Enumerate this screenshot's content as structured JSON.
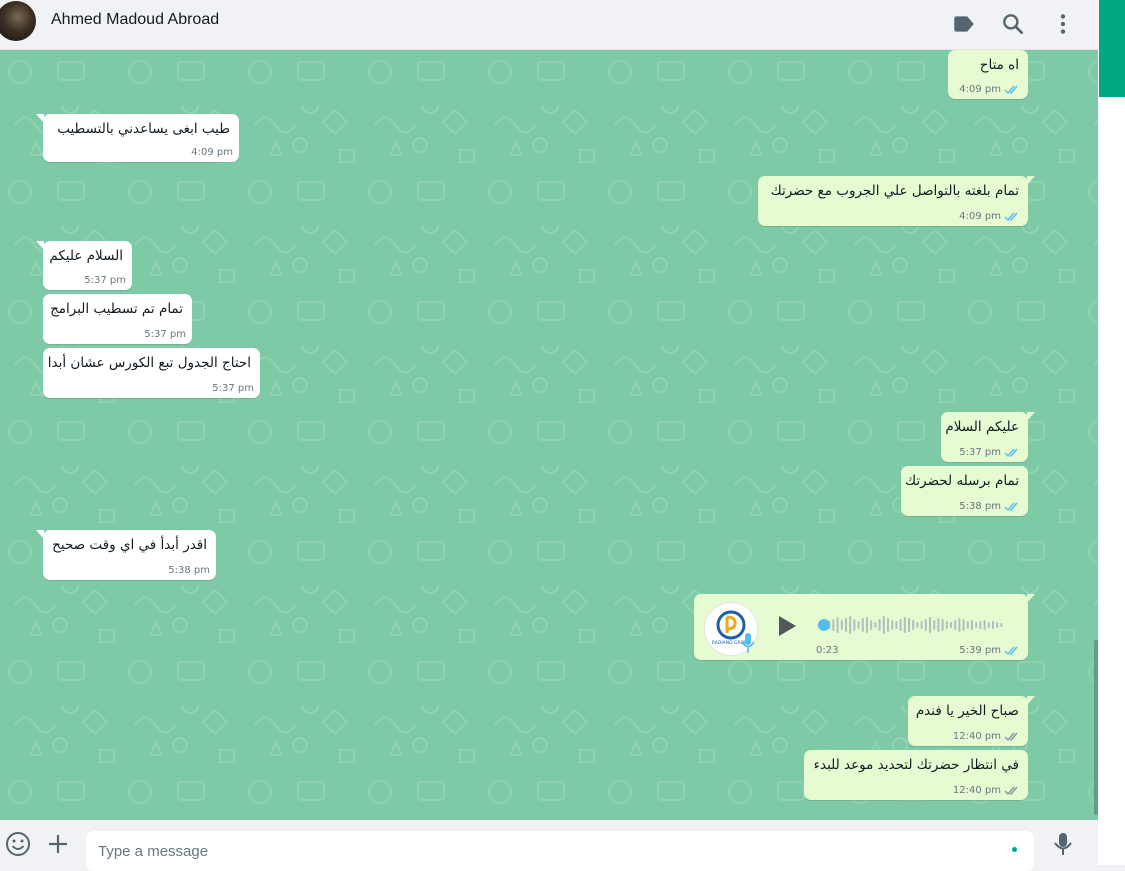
{
  "header": {
    "contact_name": "Ahmed Madoud Abroad",
    "icons": [
      "label-icon",
      "search-icon",
      "menu-icon"
    ]
  },
  "messages": [
    {
      "dir": "out",
      "text": "اه متاح",
      "time": "4:09 pm",
      "status": "read"
    },
    {
      "dir": "in",
      "text": "طيب ابغى يساعدني بالتسطيب",
      "time": "4:09 pm"
    },
    {
      "dir": "out",
      "text": "تمام بلغته بالتواصل علي الجروب مع حضرتك",
      "time": "4:09 pm",
      "status": "read"
    },
    {
      "dir": "in",
      "text": "السلام عليكم",
      "time": "5:37 pm"
    },
    {
      "dir": "in",
      "text": "تمام تم تسطيب البرامج",
      "time": "5:37 pm"
    },
    {
      "dir": "in",
      "text": "احتاج الجدول تبع الكورس عشان أبدا",
      "time": "5:37 pm"
    },
    {
      "dir": "out",
      "text": "عليكم السلام",
      "time": "5:37 pm",
      "status": "read"
    },
    {
      "dir": "out",
      "text": "تمام برسله لحضرتك",
      "time": "5:38 pm",
      "status": "read"
    },
    {
      "dir": "in",
      "text": "اقدر أبدأ في اي وقت صحيح",
      "time": "5:38 pm"
    },
    {
      "dir": "out",
      "type": "voice",
      "duration": "0:23",
      "time": "5:39 pm",
      "status": "read",
      "avatar_text": "RADIANG GROUP",
      "progress": 0.0
    },
    {
      "dir": "out",
      "text": "صباح الخير يا فندم",
      "time": "12:40 pm",
      "status": "delivered"
    },
    {
      "dir": "out",
      "text": "في انتظار حضرتك لتحديد موعد للبدء",
      "time": "12:40 pm",
      "status": "delivered"
    }
  ],
  "composer": {
    "placeholder": "Type a message",
    "icons": [
      "emoji-icon",
      "attach-plus-icon",
      "microphone-icon"
    ]
  },
  "colors": {
    "chat_bg": "#7fcaa6",
    "outgoing_bubble": "#e6fbd2",
    "incoming_bubble": "#ffffff",
    "read_tick": "#53bdeb",
    "accent": "#00a884"
  }
}
